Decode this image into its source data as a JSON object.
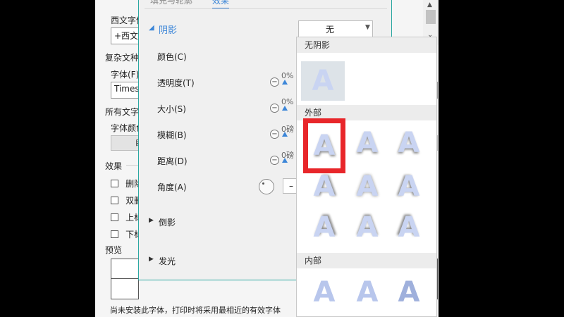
{
  "back_dialog": {
    "western_font_label": "西文字体",
    "western_font_value": "+西文",
    "complex_font_label": "复杂文种",
    "complex_font_sub": "字体(F)",
    "complex_font_value": "Times",
    "all_text_label": "所有文字",
    "font_color_label": "字体颜色",
    "color_btn": "自",
    "effects_label": "效果",
    "checkboxes": [
      "删除线",
      "双删除线",
      "上标",
      "下标"
    ],
    "preview_label": "预览",
    "notice": "尚未安装此字体，打印时将采用最相近的有效字体"
  },
  "effects_panel": {
    "tab_left": "填充与轮廓",
    "tab_right": "效果",
    "shadow_label": "阴影",
    "shadow_value": "无",
    "rows": [
      {
        "label": "颜色(C)"
      },
      {
        "label": "透明度(T)",
        "value": "0%"
      },
      {
        "label": "大小(S)",
        "value": "0%"
      },
      {
        "label": "模糊(B)",
        "value": "0磅"
      },
      {
        "label": "距离(D)",
        "value": "0磅"
      },
      {
        "label": "角度(A)",
        "value": "–"
      }
    ],
    "reflection_label": "倒影",
    "glow_label": "发光"
  },
  "popup": {
    "no_shadow": "无阴影",
    "outer": "外部",
    "inner": "内部",
    "glyph": "A"
  },
  "colors": {
    "accent": "#3c86d8",
    "selection": "#e8262a",
    "panel_border": "#2aa7a1"
  }
}
